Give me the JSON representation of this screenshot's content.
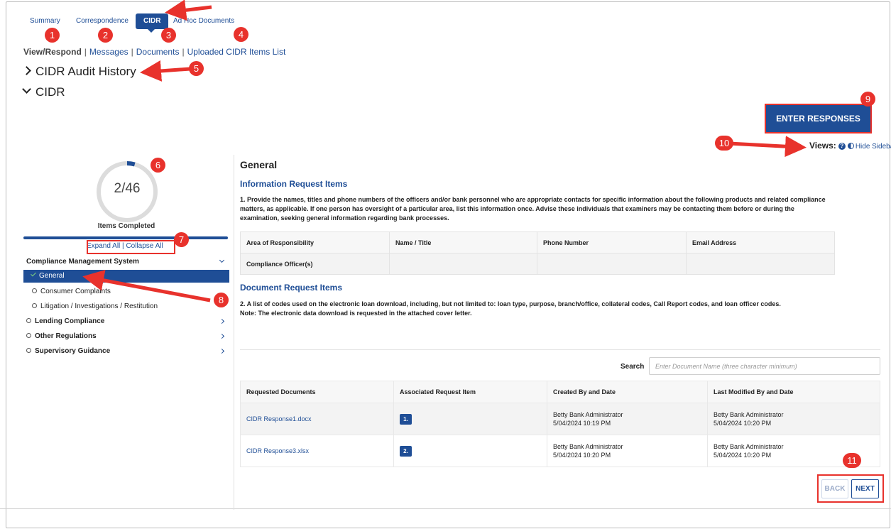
{
  "tabs": [
    {
      "label": "Summary",
      "active": false
    },
    {
      "label": "Correspondence",
      "active": false
    },
    {
      "label": "CIDR",
      "active": true
    },
    {
      "label": "Ad Hoc Documents",
      "active": false
    }
  ],
  "subnav": {
    "current": "View/Respond",
    "separator": "|",
    "links": [
      "Messages",
      "Documents",
      "Uploaded CIDR Items List"
    ]
  },
  "sections": {
    "audit_history": "CIDR Audit History",
    "cidr": "CIDR"
  },
  "actions": {
    "enter_responses": "ENTER RESPONSES"
  },
  "views": {
    "label": "Views:",
    "help_icon": "?",
    "hide_sidebar": "Hide Sidebar"
  },
  "sidebar": {
    "progress": {
      "completed": 2,
      "total": 46,
      "display": "2/46"
    },
    "items_completed_label": "Items Completed",
    "expand_all": "Expand All",
    "divider": "|",
    "collapse_all": "Collapse All",
    "groups": [
      {
        "label": "Compliance Management System",
        "expanded": true,
        "items": [
          {
            "label": "General",
            "active": true,
            "completed": true
          },
          {
            "label": "Consumer Complaints",
            "active": false,
            "completed": false
          },
          {
            "label": "Litigation / Investigations / Restitution",
            "active": false,
            "completed": false
          }
        ]
      },
      {
        "label": "Lending Compliance",
        "expanded": false
      },
      {
        "label": "Other Regulations",
        "expanded": false
      },
      {
        "label": "Supervisory Guidance",
        "expanded": false
      }
    ]
  },
  "main": {
    "title": "General",
    "info_heading": "Information Request Items",
    "info_text": "1.  Provide the names, titles and phone numbers of the officers and/or bank personnel who are appropriate contacts for specific information about the following products and related compliance matters, as applicable. If one person has oversight of a particular area, list this information once. Advise these individuals that examiners may be contacting them before or during the examination, seeking general information regarding bank processes.",
    "info_table": {
      "headers": [
        "Area of Responsibility",
        "Name / Title",
        "Phone Number",
        "Email Address"
      ],
      "rows": [
        [
          "Compliance Officer(s)",
          "",
          "",
          ""
        ]
      ]
    },
    "doc_heading": "Document Request Items",
    "doc_text_1": "2.  A list of codes used on the electronic loan download, including, but not limited to: loan type, purpose, branch/office, collateral codes, Call Report codes, and loan officer codes.",
    "doc_text_2": "Note: The electronic data download is requested in the attached cover letter.",
    "search": {
      "label": "Search",
      "placeholder": "Enter Document Name (three character minimum)"
    },
    "docs_table": {
      "headers": [
        "Requested Documents",
        "Associated Request Item",
        "Created By and Date",
        "Last Modified By and Date"
      ],
      "rows": [
        {
          "name": "CIDR Response1.docx",
          "item": "1.",
          "created_by": "Betty Bank Administrator",
          "created_date": "5/04/2024 10:19 PM",
          "modified_by": "Betty Bank Administrator",
          "modified_date": "5/04/2024 10:20 PM"
        },
        {
          "name": "CIDR Response3.xlsx",
          "item": "2.",
          "created_by": "Betty Bank Administrator",
          "created_date": "5/04/2024 10:20 PM",
          "modified_by": "Betty Bank Administrator",
          "modified_date": "5/04/2024 10:20 PM"
        }
      ]
    },
    "pagination": {
      "back": "BACK",
      "next": "NEXT"
    }
  },
  "annotations": [
    "1",
    "2",
    "3",
    "4",
    "5",
    "6",
    "7",
    "8",
    "9",
    "10",
    "11"
  ],
  "colors": {
    "primary": "#1f4e96",
    "annotation": "#e8322c",
    "check": "#7ed37e"
  }
}
